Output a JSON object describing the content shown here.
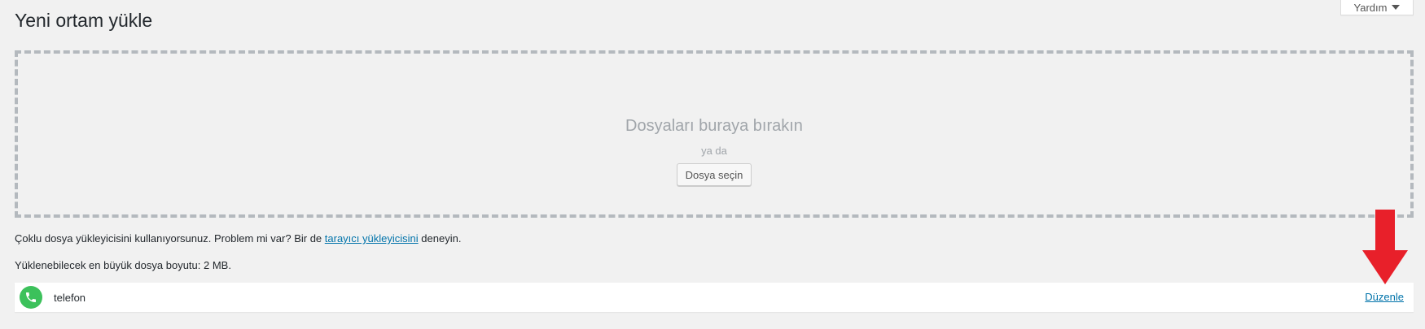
{
  "page_title": "Yeni ortam yükle",
  "help_tab": {
    "label": "Yardım",
    "icon": "caret-down-icon"
  },
  "uploader": {
    "drop_title": "Dosyaları buraya bırakın",
    "or_text": "ya da",
    "select_button": "Dosya seçin"
  },
  "notice": {
    "prefix": "Çoklu dosya yükleyicisini kullanıyorsunuz. Problem mi var? Bir de",
    "link": "tarayıcı yükleyicisini",
    "suffix": "deneyin."
  },
  "max_size_text": "Yüklenebilecek en büyük dosya boyutu: 2 MB.",
  "media_item": {
    "icon": "phone-icon",
    "filename": "telefon",
    "edit_link": "Düzenle"
  },
  "colors": {
    "background": "#f1f1f1",
    "link": "#0073aa",
    "thumb_green": "#3cc15b",
    "arrow_red": "#e8202a"
  }
}
